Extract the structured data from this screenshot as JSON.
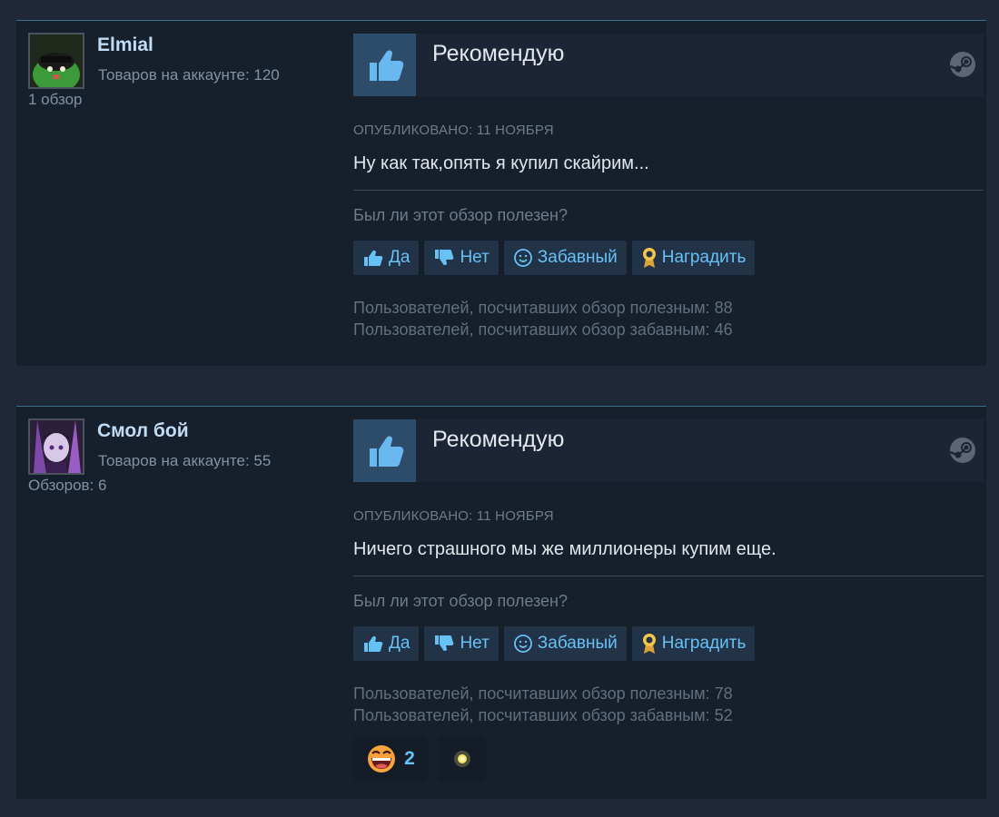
{
  "reviews": [
    {
      "author": {
        "name": "Elmial",
        "games": "Товаров на аккаунте: 120",
        "reviews": "1 обзор"
      },
      "verdict": "Рекомендую",
      "posted": "Опубликовано: 11 ноября",
      "text": "Ну как так,опять я купил скайрим...",
      "helpful_question": "Был ли этот обзор полезен?",
      "buttons": {
        "yes": "Да",
        "no": "Нет",
        "funny": "Забавный",
        "award": "Наградить"
      },
      "stats": {
        "helpful": "Пользователей, посчитавших обзор полезным: 88",
        "funny": "Пользователей, посчитавших обзор забавным: 46"
      }
    },
    {
      "author": {
        "name": "Смол бой",
        "games": "Товаров на аккаунте: 55",
        "reviews": "Обзоров: 6"
      },
      "verdict": "Рекомендую",
      "posted": "Опубликовано: 11 ноября",
      "text": "Ничего страшного мы же миллионеры купим еще.",
      "helpful_question": "Был ли этот обзор полезен?",
      "buttons": {
        "yes": "Да",
        "no": "Нет",
        "funny": "Забавный",
        "award": "Наградить"
      },
      "stats": {
        "helpful": "Пользователей, посчитавших обзор полезным: 78",
        "funny": "Пользователей, посчитавших обзор забавным: 52"
      },
      "awards": [
        {
          "icon": "laughing-face-icon",
          "count": "2"
        },
        {
          "icon": "sparkle-icon"
        }
      ]
    }
  ],
  "colors": {
    "page_bg": "#1e2837",
    "card_bg": "#16202d",
    "accent": "#67c1f5",
    "thumb_box": "#2d4c6a",
    "award_gold": "#f2c84b"
  }
}
